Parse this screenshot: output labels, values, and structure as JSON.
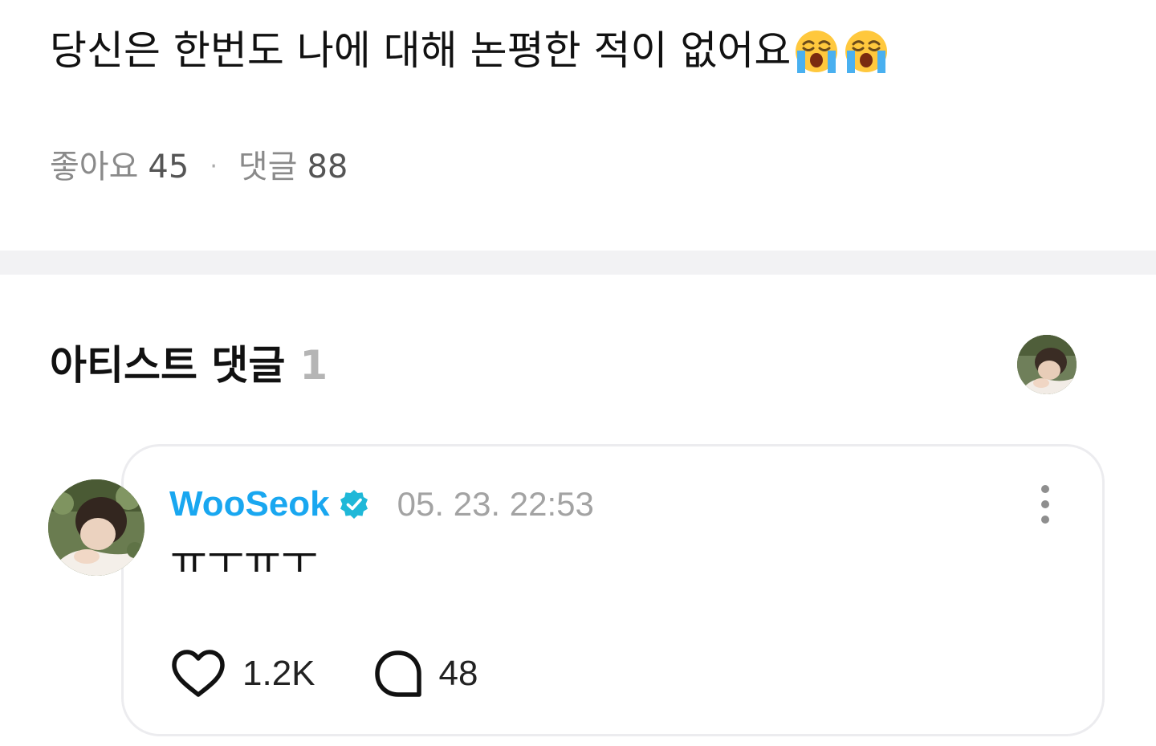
{
  "post": {
    "text": "당신은 한번도 나에 대해 논평한 적이 없어요",
    "emoji": [
      "loudly-crying-face",
      "loudly-crying-face"
    ]
  },
  "stats": {
    "likes_label": "좋아요",
    "likes_count": "45",
    "separator": "·",
    "comments_label": "댓글",
    "comments_count": "88"
  },
  "artist_comments": {
    "title": "아티스트 댓글",
    "count": "1"
  },
  "comment": {
    "author": "WooSeok",
    "verified": true,
    "timestamp": "05. 23. 22:53",
    "text": "ㅠㅜㅠㅜ",
    "likes": "1.2K",
    "replies": "48"
  },
  "colors": {
    "author_name": "#19a7f0",
    "verified_badge": "#1fb8d8",
    "muted_text": "#8a8a8a",
    "divider": "#f2f2f4",
    "card_border": "#ececef"
  },
  "icons": {
    "like": "heart-outline-icon",
    "reply": "speech-bubble-icon",
    "more": "more-vertical-icon",
    "verified": "verified-badge-icon"
  }
}
